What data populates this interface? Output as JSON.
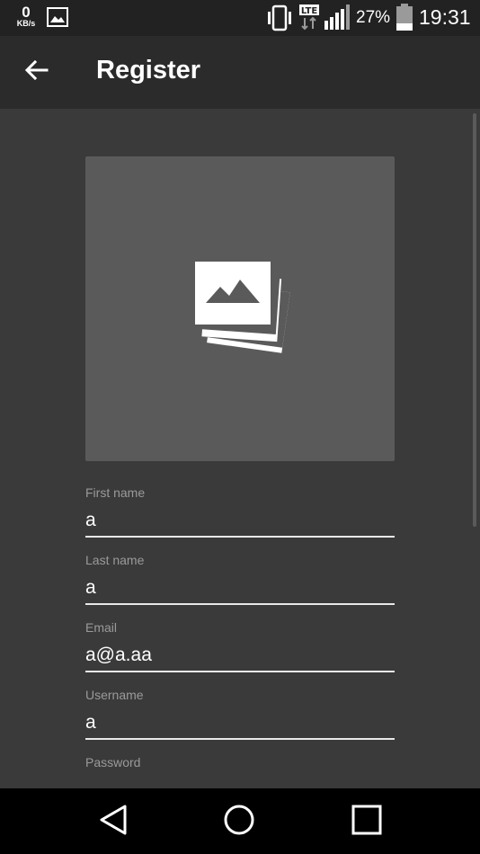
{
  "status_bar": {
    "net_speed_value": "0",
    "net_speed_unit": "KB/s",
    "network_type": "LTE",
    "battery_percent": "27%",
    "time": "19:31"
  },
  "app_bar": {
    "title": "Register",
    "back_icon": "arrow-back-icon"
  },
  "image_picker": {
    "icon": "photo-library-icon"
  },
  "form": {
    "fields": [
      {
        "label": "First name",
        "value": "a"
      },
      {
        "label": "Last name",
        "value": "a"
      },
      {
        "label": "Email",
        "value": "a@a.aa"
      },
      {
        "label": "Username",
        "value": "a"
      },
      {
        "label": "Password",
        "value": ""
      }
    ]
  },
  "nav_bar": {
    "back_icon": "triangle-back-icon",
    "home_icon": "circle-home-icon",
    "recents_icon": "square-recents-icon"
  },
  "colors": {
    "status_bar_bg": "#222222",
    "app_bar_bg": "#2b2b2b",
    "content_bg": "#3a3a3a",
    "image_placeholder_bg": "#5a5a5b",
    "label_text": "#9a9a9a",
    "input_underline": "#e8e8e8"
  }
}
